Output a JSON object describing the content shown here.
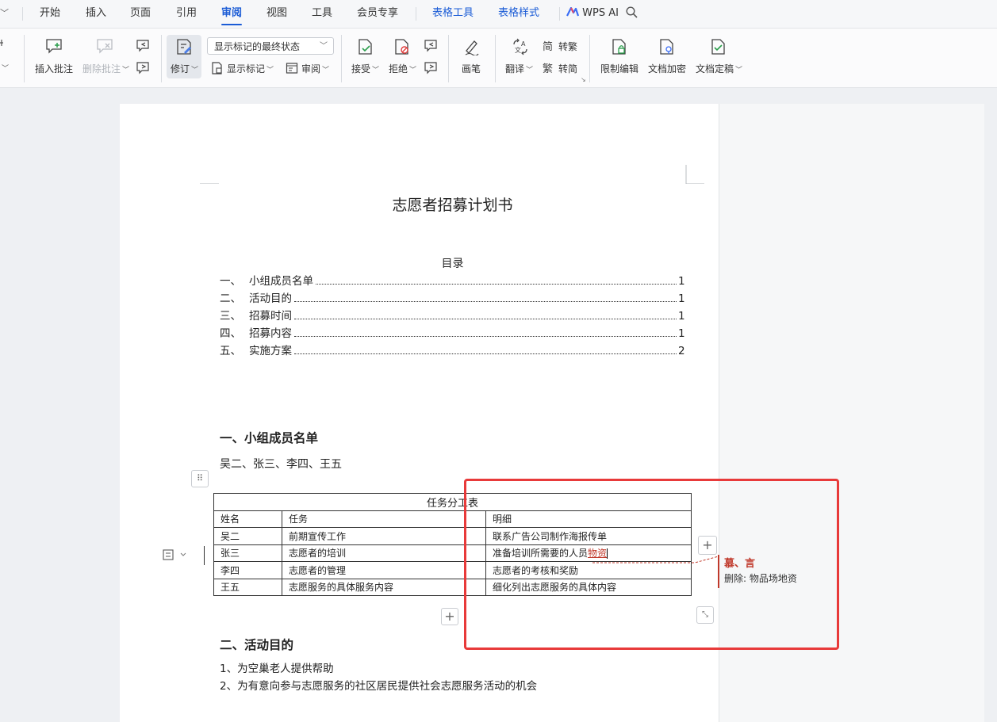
{
  "tabs": {
    "items": [
      "开始",
      "插入",
      "页面",
      "引用",
      "审阅",
      "视图",
      "工具",
      "会员专享",
      "表格工具",
      "表格样式"
    ],
    "active": "审阅",
    "wps_ai": "WPS AI"
  },
  "ribbon": {
    "insert_comment": "插入批注",
    "delete_comment": "删除批注",
    "track_changes": "修订",
    "markup_mode": "显示标记的最终状态",
    "show_markup": "显示标记",
    "review": "审阅",
    "accept": "接受",
    "reject": "拒绝",
    "pen": "画笔",
    "translate": "翻译",
    "to_traditional": "转繁",
    "to_simplified": "转简",
    "restrict_edit": "限制编辑",
    "encrypt": "文档加密",
    "finalize": "文档定稿"
  },
  "document": {
    "title": "志愿者招募计划书",
    "toc_title": "目录",
    "toc": [
      {
        "num": "一、",
        "text": "小组成员名单",
        "page": "1"
      },
      {
        "num": "二、",
        "text": "活动目的",
        "page": "1"
      },
      {
        "num": "三、",
        "text": "招募时间",
        "page": "1"
      },
      {
        "num": "四、",
        "text": "招募内容",
        "page": "1"
      },
      {
        "num": "五、",
        "text": "实施方案",
        "page": "2"
      }
    ],
    "section1_heading": "一、小组成员名单",
    "members": "吴二、张三、李四、王五",
    "table": {
      "caption": "任务分工表",
      "headers": [
        "姓名",
        "任务",
        "明细"
      ],
      "rows": [
        [
          "吴二",
          "前期宣传工作",
          "联系广告公司制作海报传单"
        ],
        [
          "张三",
          "志愿者的培训",
          "准备培训所需要的人员"
        ],
        [
          "李四",
          "志愿者的管理",
          "志愿者的考核和奖励"
        ],
        [
          "王五",
          "志愿服务的具体服务内容",
          "细化列出志愿服务的具体内容"
        ]
      ],
      "inserted_text": "物资"
    },
    "section2_heading": "二、活动目的",
    "purpose": [
      "1、为空巢老人提供帮助",
      "2、为有意向参与志愿服务的社区居民提供社会志愿服务活动的机会"
    ]
  },
  "revision": {
    "author": "慕、言",
    "text": "删除: 物品场地资"
  },
  "colors": {
    "accent": "#1b5cd6",
    "revision": "#c0392b",
    "highlight_box": "#e83a3a"
  }
}
